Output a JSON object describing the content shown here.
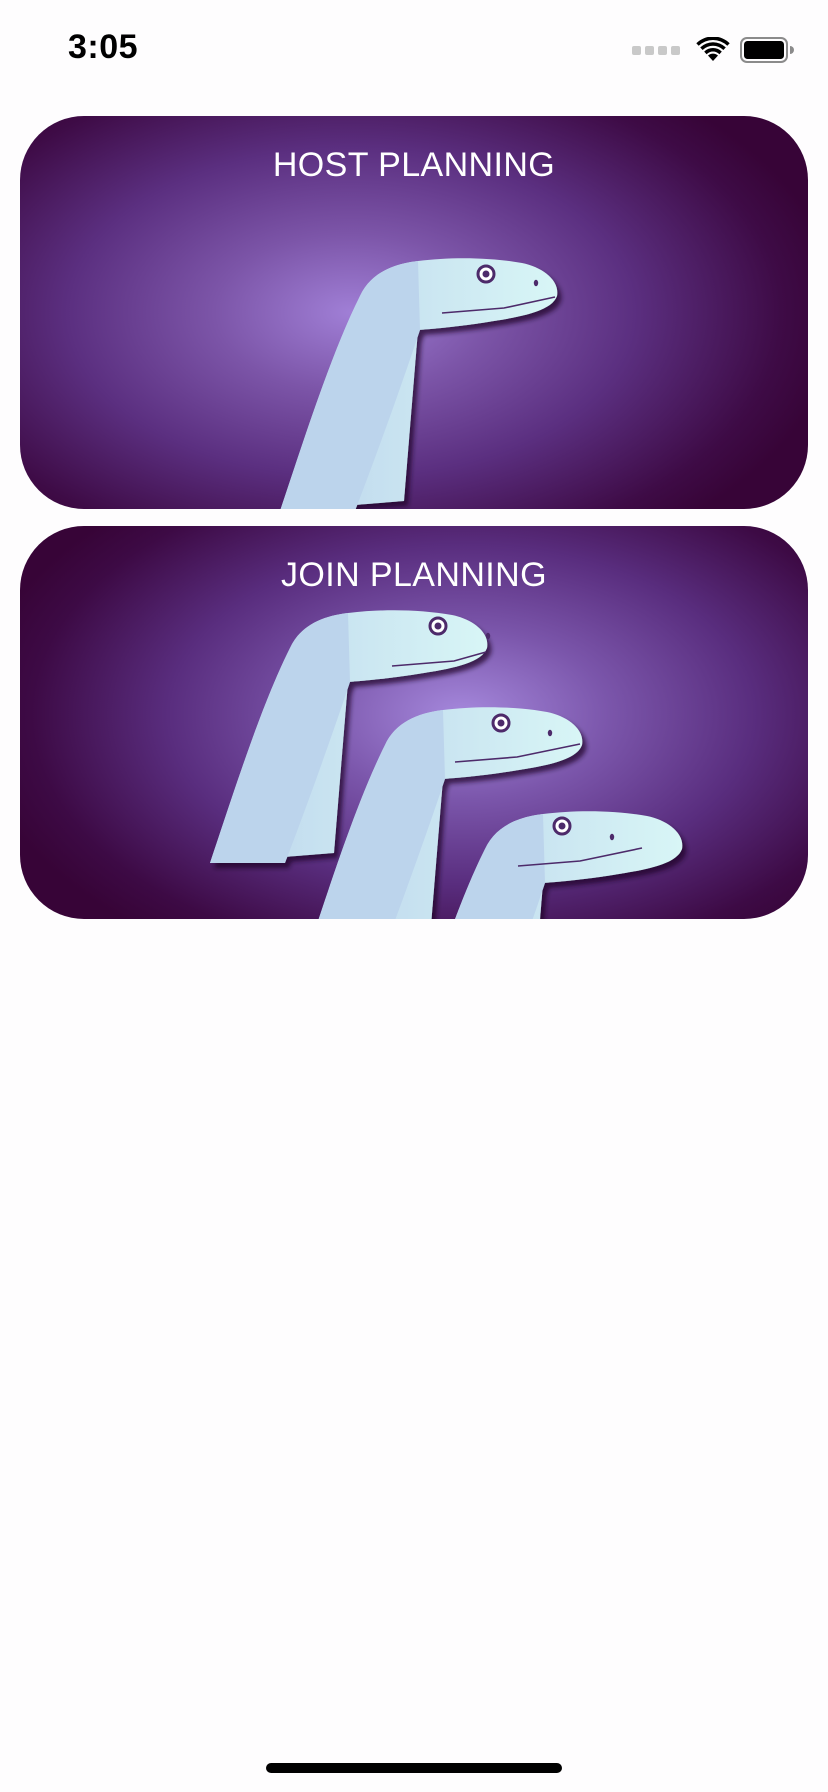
{
  "status_bar": {
    "time": "3:05",
    "icons": [
      "cellular-signal-icon",
      "wifi-icon",
      "battery-icon"
    ]
  },
  "cards": [
    {
      "title": "HOST PLANNING",
      "illustration": "one-snake"
    },
    {
      "title": "JOIN PLANNING",
      "illustration": "three-snakes"
    }
  ],
  "colors": {
    "card_edge": "#370437",
    "card_center": "#a07fd6",
    "snake_body": "#bcd4ec",
    "snake_head_highlight": "#d6f5f6",
    "text": "#ffffff"
  }
}
